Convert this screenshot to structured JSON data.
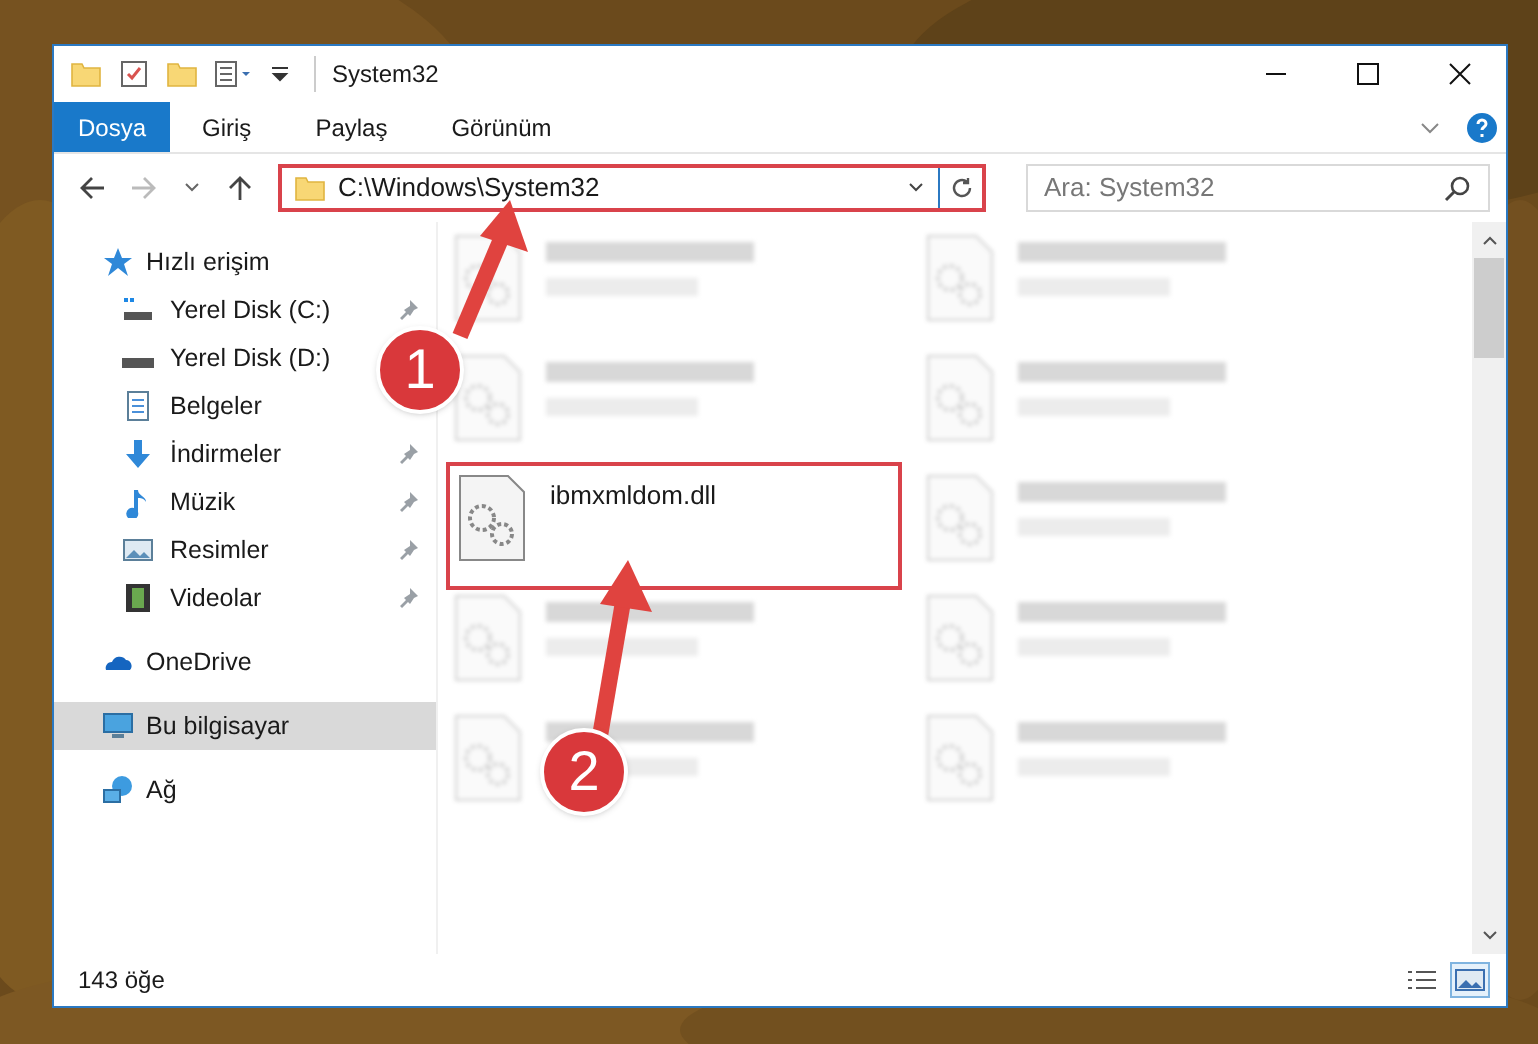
{
  "window": {
    "title": "System32"
  },
  "ribbon_tabs": [
    {
      "label": "Dosya",
      "kind": "file"
    },
    {
      "label": "Giriş",
      "kind": "tab"
    },
    {
      "label": "Paylaş",
      "kind": "tab"
    },
    {
      "label": "Görünüm",
      "kind": "tab"
    }
  ],
  "address": {
    "path": "C:\\Windows\\System32",
    "highlighted": true
  },
  "search": {
    "placeholder": "Ara: System32"
  },
  "sidebar": {
    "items": [
      {
        "label": "Hızlı erişim",
        "selected": false,
        "children": [
          {
            "label": "Yerel Disk (C:)",
            "pinned": true
          },
          {
            "label": "Yerel Disk (D:)",
            "pinned": false
          },
          {
            "label": "Belgeler",
            "pinned": false
          },
          {
            "label": "İndirmeler",
            "pinned": true
          },
          {
            "label": "Müzik",
            "pinned": true
          },
          {
            "label": "Resimler",
            "pinned": true
          },
          {
            "label": "Videolar",
            "pinned": true
          }
        ]
      },
      {
        "label": "OneDrive",
        "selected": false
      },
      {
        "label": "Bu bilgisayar",
        "selected": true
      },
      {
        "label": "Ağ",
        "selected": false
      }
    ]
  },
  "files": [
    {
      "blurred": true,
      "highlighted": false
    },
    {
      "blurred": true,
      "highlighted": false
    },
    {
      "blurred": true,
      "highlighted": false
    },
    {
      "blurred": true,
      "highlighted": false
    },
    {
      "name": "ibmxmldom.dll",
      "blurred": false,
      "highlighted": true
    },
    {
      "blurred": true,
      "highlighted": false
    },
    {
      "blurred": true,
      "highlighted": false
    },
    {
      "blurred": true,
      "highlighted": false
    },
    {
      "blurred": true,
      "highlighted": false
    },
    {
      "blurred": true,
      "highlighted": false
    }
  ],
  "status_bar": {
    "count": "143 öğe"
  },
  "view_buttons": [
    {
      "selected": false
    },
    {
      "selected": true
    }
  ],
  "annotations": [
    {
      "number": "1"
    },
    {
      "number": "2"
    }
  ]
}
